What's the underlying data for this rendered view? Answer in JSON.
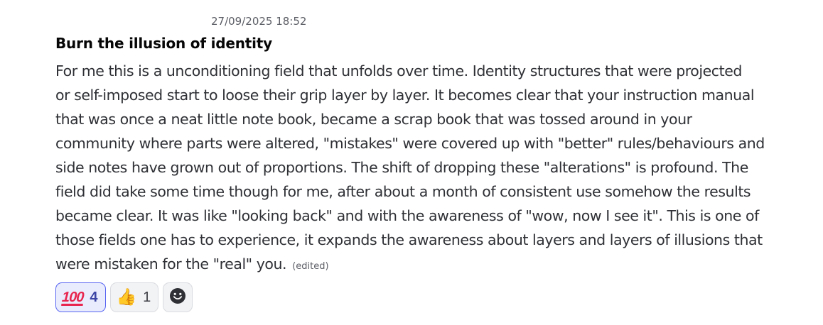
{
  "message": {
    "timestamp": "27/09/2025 18:52",
    "title": "Burn the illusion of identity",
    "body_lines": [
      "For me this is a unconditioning field that unfolds over time. Identity structures that were projected",
      "or self-imposed start to loose their grip layer by layer. It becomes clear that your instruction manual",
      "that was once a neat little note book, became a scrap book that was tossed around in your",
      "community where parts were altered, \"mistakes\" were covered up with \"better\" rules/behaviours and",
      "side notes have grown out of proportions. The shift of dropping these \"alterations\" is profound. The",
      "field did take some time though for me, after about a month of consistent use somehow the results",
      "became clear. It was like \"looking back\" and with the awareness of \"wow, now I see it\". This is one of",
      "those fields one has to experience, it expands the awareness about layers and layers of illusions that",
      "were mistaken for the \"real\" you."
    ],
    "edited_label": "(edited)"
  },
  "reactions": [
    {
      "emoji": "100",
      "icon": "hundred-points-icon",
      "count": "4",
      "active": true
    },
    {
      "emoji": "👍",
      "icon": "thumbs-up-icon",
      "count": "1",
      "active": false
    }
  ],
  "add_reaction": {
    "icon": "add-reaction-smiley-icon"
  },
  "colors": {
    "accent": "#5865f2",
    "active_bg": "#e9ecfc",
    "hundred_red": "#e8254f",
    "text": "#2e3035"
  }
}
